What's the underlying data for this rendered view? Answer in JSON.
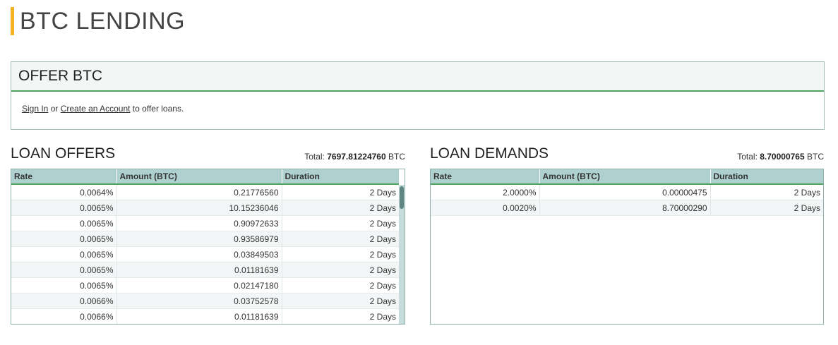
{
  "page": {
    "title": "BTC LENDING"
  },
  "offer_box": {
    "title": "OFFER BTC",
    "sign_in": "Sign In",
    "or_text": "or",
    "create_account": "Create an Account",
    "suffix": "to offer loans."
  },
  "loan_offers": {
    "title": "LOAN OFFERS",
    "total_label": "Total:",
    "total_value": "7697.81224760",
    "total_unit": "BTC",
    "columns": [
      "Rate",
      "Amount (BTC)",
      "Duration"
    ],
    "rows": [
      [
        "0.0064%",
        "0.21776560",
        "2 Days"
      ],
      [
        "0.0065%",
        "10.15236046",
        "2 Days"
      ],
      [
        "0.0065%",
        "0.90972633",
        "2 Days"
      ],
      [
        "0.0065%",
        "0.93586979",
        "2 Days"
      ],
      [
        "0.0065%",
        "0.03849503",
        "2 Days"
      ],
      [
        "0.0065%",
        "0.01181639",
        "2 Days"
      ],
      [
        "0.0065%",
        "0.02147180",
        "2 Days"
      ],
      [
        "0.0066%",
        "0.03752578",
        "2 Days"
      ],
      [
        "0.0066%",
        "0.01181639",
        "2 Days"
      ]
    ]
  },
  "loan_demands": {
    "title": "LOAN DEMANDS",
    "total_label": "Total:",
    "total_value": "8.70000765",
    "total_unit": "BTC",
    "columns": [
      "Rate",
      "Amount (BTC)",
      "Duration"
    ],
    "rows": [
      [
        "2.0000%",
        "0.00000475",
        "2 Days"
      ],
      [
        "0.0020%",
        "8.70000290",
        "2 Days"
      ]
    ]
  },
  "colors": {
    "accent": "#f5b321",
    "header_green": "#4ca35e",
    "table_header": "#aed0cf"
  }
}
